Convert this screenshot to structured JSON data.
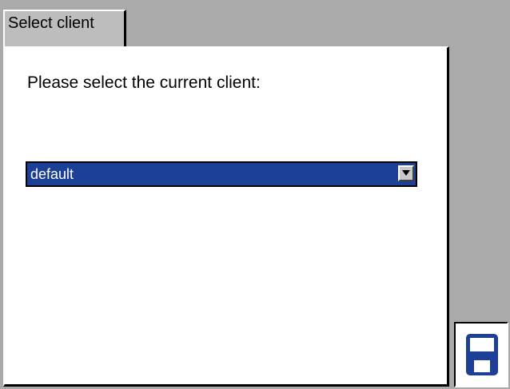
{
  "tab": {
    "label": "Select client"
  },
  "main": {
    "prompt": "Please select the current client:",
    "client_select": {
      "value": "default"
    }
  },
  "icons": {
    "dropdown": "chevron-down-icon",
    "save": "floppy-disk-icon"
  },
  "colors": {
    "background": "#aaaaaa",
    "panel": "#ffffff",
    "selection": "#1c3f98",
    "save_icon": "#1c3f98"
  }
}
